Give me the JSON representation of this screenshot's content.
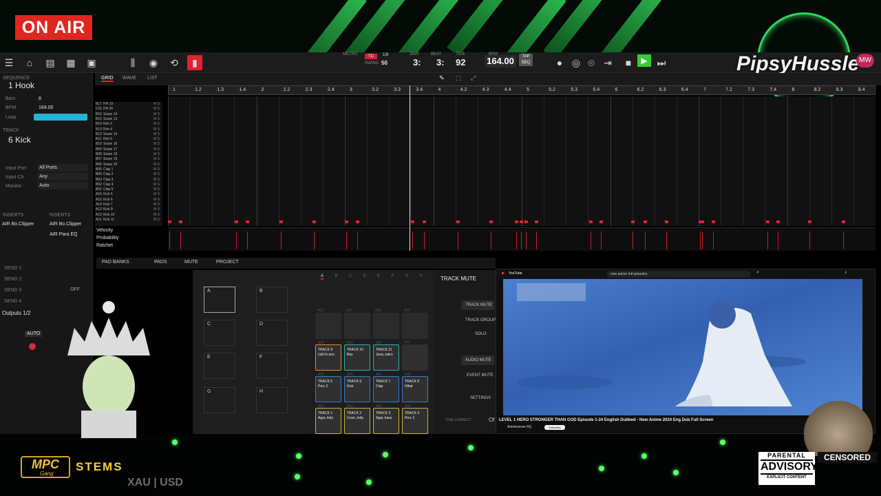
{
  "overlay": {
    "on_air": "ON AIR",
    "brand": "PipsyHussle",
    "brand_badge": "MW",
    "mpc_logo": "MPC",
    "mpc_sub": "Gang",
    "stems": "STEMS",
    "ticker": "XAU | USD",
    "advisory_top": "PARENTAL",
    "advisory_mid": "ADVISORY",
    "advisory_bottom": "EXPLICIT CONTENT",
    "censored": "CENSORED"
  },
  "toolbar": {
    "metro_label": "METRO",
    "swing_label": "SWING",
    "swing_value": "50",
    "tc_badge": "TC",
    "tc_value": "1/8",
    "bar_label": "BAR",
    "bar_value": "3:",
    "beat_label": "BEAT",
    "beat_value": "3:",
    "tick_label": "TICK",
    "tick_value": "92",
    "bpm_label": "BPM",
    "bpm_value": "164.00",
    "tap_label": "TAP",
    "tap_sub": "SEQ",
    "icons": [
      "menu-icon",
      "home-icon",
      "browse-icon",
      "grid-icon",
      "window-icon",
      "mixer-icon",
      "record-icon",
      "loop-icon",
      "sample-icon"
    ]
  },
  "sequence": {
    "section_label": "SEQUENCE",
    "name": "1 Hook",
    "bars_label": "Bars",
    "bars_value": "8",
    "bpm_label": "BPM",
    "bpm_value": "164.00",
    "loop_label": "Loop",
    "track_label": "TRACK",
    "track_name": "6 Kick",
    "input_port_label": "Input Port",
    "input_port_value": "All Ports",
    "input_ch_label": "Input Ch",
    "input_ch_value": "Any",
    "monitor_label": "Monitor",
    "monitor_value": "Auto",
    "inserts_label": "INSERTS",
    "insert_left": "AIR Bo.Clipper",
    "insert_right_1": "AIR Bo.Clipper",
    "insert_right_2": "AIR Para EQ",
    "sends": [
      "SEND 1",
      "SEND 2",
      "SEND 3",
      "SEND 4"
    ],
    "outputs": "Outputs 1/2",
    "auto_label": "AUTO",
    "off_label": "OFF"
  },
  "editor": {
    "tabs": [
      "GRID",
      "WAVE",
      "LIST"
    ],
    "ruler": [
      "1",
      "1.2",
      "1.3",
      "1.4",
      "2",
      "2.2",
      "2.3",
      "2.4",
      "3",
      "3.2",
      "3.3",
      "3.4",
      "4",
      "4.2",
      "4.3",
      "4.4",
      "5",
      "5.2",
      "5.3",
      "5.4",
      "6",
      "6.2",
      "6.3",
      "6.4",
      "7",
      "7.2",
      "7.3",
      "7.4",
      "8",
      "8.2",
      "8.3",
      "8.4"
    ],
    "tracks": [
      {
        "num": "B17",
        "name": "HH 19"
      },
      {
        "num": "C01",
        "name": "HH 20"
      },
      {
        "num": "B16",
        "name": "Snare 14"
      },
      {
        "num": "B15",
        "name": "Snare 13"
      },
      {
        "num": "B14",
        "name": "Rim 3"
      },
      {
        "num": "B13",
        "name": "Rim 4"
      },
      {
        "num": "B12",
        "name": "Snare 15"
      },
      {
        "num": "B11",
        "name": "Rim 5"
      },
      {
        "num": "B10",
        "name": "Snare 16"
      },
      {
        "num": "B09",
        "name": "Snare 17"
      },
      {
        "num": "B08",
        "name": "Snare 18"
      },
      {
        "num": "B07",
        "name": "Snare 19"
      },
      {
        "num": "B06",
        "name": "Snare 20"
      },
      {
        "num": "B05",
        "name": "Clap 1"
      },
      {
        "num": "B04",
        "name": "Clap 2"
      },
      {
        "num": "B03",
        "name": "Clap 3"
      },
      {
        "num": "B02",
        "name": "Clap 4"
      },
      {
        "num": "B01",
        "name": "Clap 5"
      },
      {
        "num": "A16",
        "name": "Kick 5"
      },
      {
        "num": "A15",
        "name": "Kick 6"
      },
      {
        "num": "A14",
        "name": "Kick 7"
      },
      {
        "num": "A13",
        "name": "Kick 9"
      },
      {
        "num": "A12",
        "name": "Kick 10"
      },
      {
        "num": "A11",
        "name": "Kick 11"
      }
    ],
    "lanes": [
      "Velocity",
      "Probability",
      "Ratchet"
    ]
  },
  "pads": {
    "toolbar": [
      "PAD BANKS",
      "PADS",
      "MUTE",
      "PROJECT"
    ],
    "banks": [
      "A",
      "B",
      "C",
      "D",
      "E",
      "F",
      "G",
      "H"
    ],
    "bank_tabs": [
      "A",
      "B",
      "C",
      "D",
      "E",
      "F",
      "G",
      "H"
    ],
    "empty_codes": [
      "A13",
      "A14",
      "A15",
      "A16"
    ],
    "row2": [
      {
        "code": "A09",
        "title": "TRACK 9",
        "sub": "Upli.hi ano",
        "color": "orange"
      },
      {
        "code": "A10",
        "title": "TRACK 10",
        "sub": "Bas",
        "color": "teal"
      },
      {
        "code": "A11",
        "title": "TRACK 11",
        "sub": "Juna..nden",
        "color": "teal"
      },
      {
        "code": "A12",
        "title": "",
        "sub": "",
        "color": ""
      }
    ],
    "row3": [
      {
        "code": "A05",
        "title": "TRACK 5",
        "sub": "Perc 2",
        "color": "blue"
      },
      {
        "code": "A06",
        "title": "TRACK 6",
        "sub": "Kick",
        "color": "blue"
      },
      {
        "code": "A07",
        "title": "TRACK 7",
        "sub": "Clap",
        "color": "blue"
      },
      {
        "code": "A08",
        "title": "TRACK 8",
        "sub": "Hihat",
        "color": "blue"
      }
    ],
    "row4": [
      {
        "code": "A01",
        "title": "TRACK 1",
        "sub": "Agai..lody",
        "color": "yellow"
      },
      {
        "code": "A02",
        "title": "TRACK 2",
        "sub": "Coun..lody",
        "color": "yellow"
      },
      {
        "code": "A03",
        "title": "TRACK 3",
        "sub": "Agai..bass",
        "color": "yellow"
      },
      {
        "code": "A04",
        "title": "TRACK 4",
        "sub": "Perc 1",
        "color": "yellow"
      }
    ],
    "time_correct": "TIME CORRECT",
    "time_correct_value": "Of"
  },
  "mute": {
    "title": "TRACK MUTE",
    "items": [
      "TRACK MUTE",
      "TRACK GROUP",
      "SOLO",
      "AUDIO MUTE",
      "EVENT MUTE",
      "SETTINGS"
    ]
  },
  "youtube": {
    "logo": "YouTube",
    "search": "new anime full episodes",
    "title": "LEVEL 1 HERO STRONGER THAN GOD Episode 1-24 English Dubbed - New Anime 2024 Eng Dub Full Screen",
    "channel": "Animeverse HQ",
    "subscribe": "Subscribe"
  }
}
